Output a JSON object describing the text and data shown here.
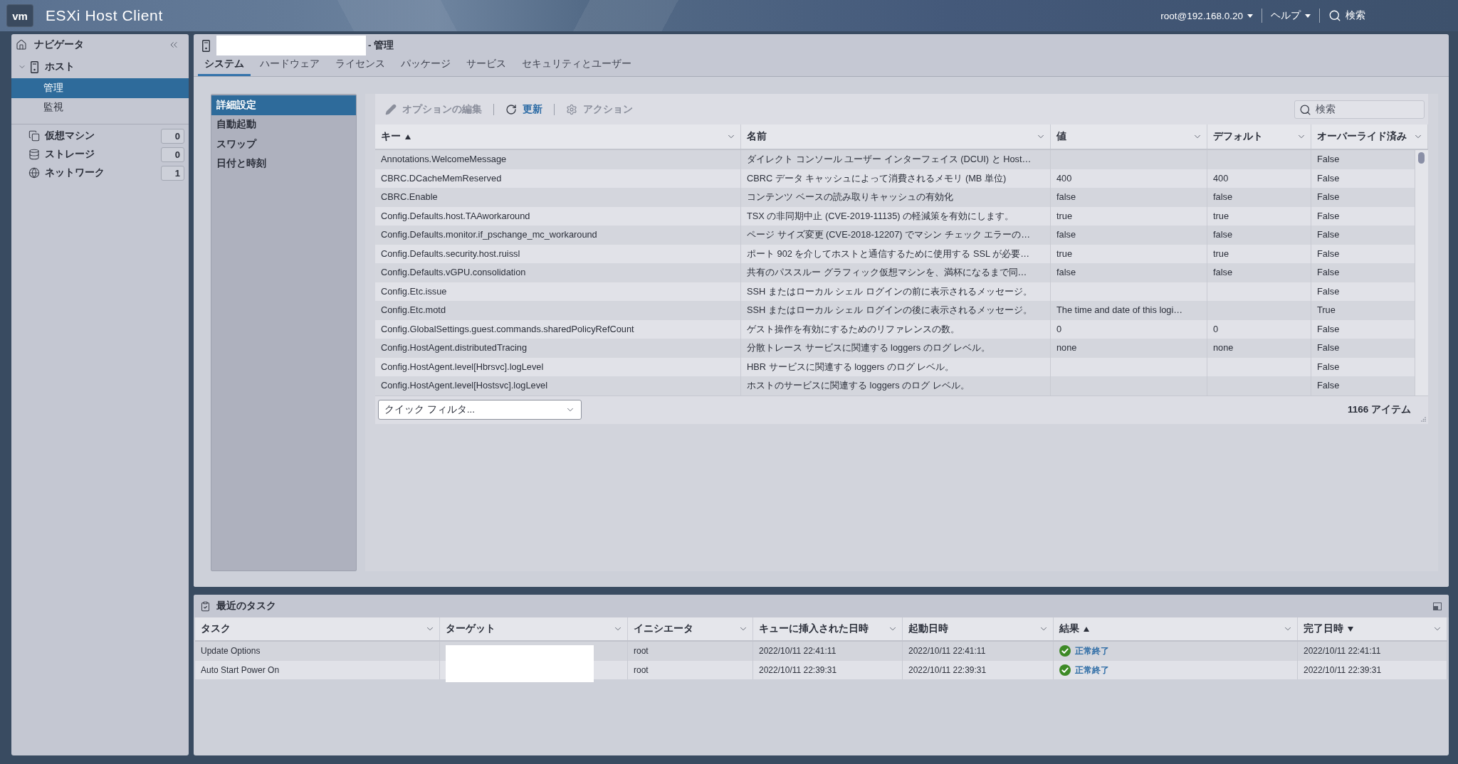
{
  "top_bar": {
    "logo": "vm",
    "title": "ESXi Host Client",
    "user_menu": "root@192.168.0.20",
    "help_menu": "ヘルプ",
    "search": "検索"
  },
  "navigator": {
    "title": "ナビゲータ",
    "tree": [
      {
        "label": "ホスト",
        "expanded": true,
        "children": [
          {
            "label": "管理",
            "selected": true
          },
          {
            "label": "監視",
            "selected": false
          }
        ]
      }
    ],
    "inventory": [
      {
        "label": "仮想マシン",
        "kind": "vm",
        "count": "0"
      },
      {
        "label": "ストレージ",
        "kind": "storage",
        "count": "0"
      },
      {
        "label": "ネットワーク",
        "kind": "network",
        "count": "1"
      }
    ]
  },
  "main": {
    "title": "- 管理",
    "tabs": [
      {
        "label": "システム",
        "selected": true
      },
      {
        "label": "ハードウェア",
        "selected": false
      },
      {
        "label": "ライセンス",
        "selected": false
      },
      {
        "label": "パッケージ",
        "selected": false
      },
      {
        "label": "サービス",
        "selected": false
      },
      {
        "label": "セキュリティとユーザー",
        "selected": false
      }
    ],
    "side_menu": [
      {
        "label": "詳細設定",
        "selected": true
      },
      {
        "label": "自動起動",
        "selected": false
      },
      {
        "label": "スワップ",
        "selected": false
      },
      {
        "label": "日付と時刻",
        "selected": false
      }
    ],
    "toolbar": [
      {
        "label": "オプションの編集",
        "kind": "edit",
        "disabled": true
      },
      {
        "label": "更新",
        "kind": "refresh",
        "disabled": false
      },
      {
        "label": "アクション",
        "kind": "actions",
        "disabled": true
      }
    ],
    "search": {
      "placeholder": "検索"
    },
    "table": {
      "columns": [
        {
          "label": "キー",
          "sorted": true,
          "descending": false
        },
        {
          "label": "名前",
          "sorted": false
        },
        {
          "label": "値",
          "sorted": false
        },
        {
          "label": "デフォルト",
          "sorted": false
        },
        {
          "label": "オーバーライド済み",
          "sorted": false
        }
      ],
      "rows": [
        {
          "key": "Annotations.WelcomeMessage",
          "name": "ダイレクト コンソール ユーザー インターフェイス (DCUI) と Host…",
          "overridden": "False"
        },
        {
          "key": "CBRC.DCacheMemReserved",
          "name": "CBRC データ キャッシュによって消費されるメモリ (MB 単位)",
          "value": "400",
          "default": "400",
          "overridden": "False"
        },
        {
          "key": "CBRC.Enable",
          "name": "コンテンツ ベースの読み取りキャッシュの有効化",
          "value": "false",
          "default": "false",
          "overridden": "False"
        },
        {
          "key": "Config.Defaults.host.TAAworkaround",
          "name": "TSX の非同期中止 (CVE-2019-11135) の軽減策を有効にします。",
          "value": "true",
          "default": "true",
          "overridden": "False"
        },
        {
          "key": "Config.Defaults.monitor.if_pschange_mc_workaround",
          "name": "ページ サイズ変更 (CVE-2018-12207) でマシン チェック エラーの…",
          "value": "false",
          "default": "false",
          "overridden": "False"
        },
        {
          "key": "Config.Defaults.security.host.ruissl",
          "name": "ポート 902 を介してホストと通信するために使用する SSL が必要…",
          "value": "true",
          "default": "true",
          "overridden": "False"
        },
        {
          "key": "Config.Defaults.vGPU.consolidation",
          "name": "共有のパススルー グラフィック仮想マシンを、満杯になるまで同…",
          "value": "false",
          "default": "false",
          "overridden": "False"
        },
        {
          "key": "Config.Etc.issue",
          "name": "SSH またはローカル シェル ログインの前に表示されるメッセージ。",
          "overridden": "False"
        },
        {
          "key": "Config.Etc.motd",
          "name": "SSH またはローカル シェル ログインの後に表示されるメッセージ。",
          "value": "The time and date of this logi…",
          "overridden": "True"
        },
        {
          "key": "Config.GlobalSettings.guest.commands.sharedPolicyRefCount",
          "name": "ゲスト操作を有効にするためのリファレンスの数。",
          "value": "0",
          "default": "0",
          "overridden": "False"
        },
        {
          "key": "Config.HostAgent.distributedTracing",
          "name": "分散トレース サービスに関連する loggers のログ レベル。",
          "value": "none",
          "default": "none",
          "overridden": "False"
        },
        {
          "key": "Config.HostAgent.level[Hbrsvc].logLevel",
          "name": "HBR サービスに関連する loggers のログ レベル。",
          "overridden": "False"
        },
        {
          "key": "Config.HostAgent.level[Hostsvc].logLevel",
          "name": "ホストのサービスに関連する loggers のログ レベル。",
          "overridden": "False"
        }
      ]
    },
    "quick_filter": {
      "value": "クイック フィルタ..."
    },
    "item_count": "1166 アイテム"
  },
  "tasks": {
    "title": "最近のタスク",
    "columns": [
      {
        "label": "タスク",
        "sorted": false
      },
      {
        "label": "ターゲット",
        "sorted": false
      },
      {
        "label": "イニシエータ",
        "sorted": false
      },
      {
        "label": "キューに挿入された日時",
        "sorted": false
      },
      {
        "label": "起動日時",
        "sorted": false
      },
      {
        "label": "結果",
        "sorted": true,
        "descending": false
      },
      {
        "label": "完了日時",
        "sorted": true,
        "descending": true
      }
    ],
    "rows": [
      {
        "task": "Update Options",
        "initiator": "root",
        "queued": "2022/10/11 22:41:11",
        "started": "2022/10/11 22:41:11",
        "result": {
          "kind": "success",
          "label": "正常終了"
        },
        "completed": "2022/10/11 22:41:11"
      },
      {
        "task": "Auto Start Power On",
        "initiator": "root",
        "queued": "2022/10/11 22:39:31",
        "started": "2022/10/11 22:39:31",
        "result": {
          "kind": "success",
          "label": "正常終了"
        },
        "completed": "2022/10/11 22:39:31"
      }
    ]
  }
}
